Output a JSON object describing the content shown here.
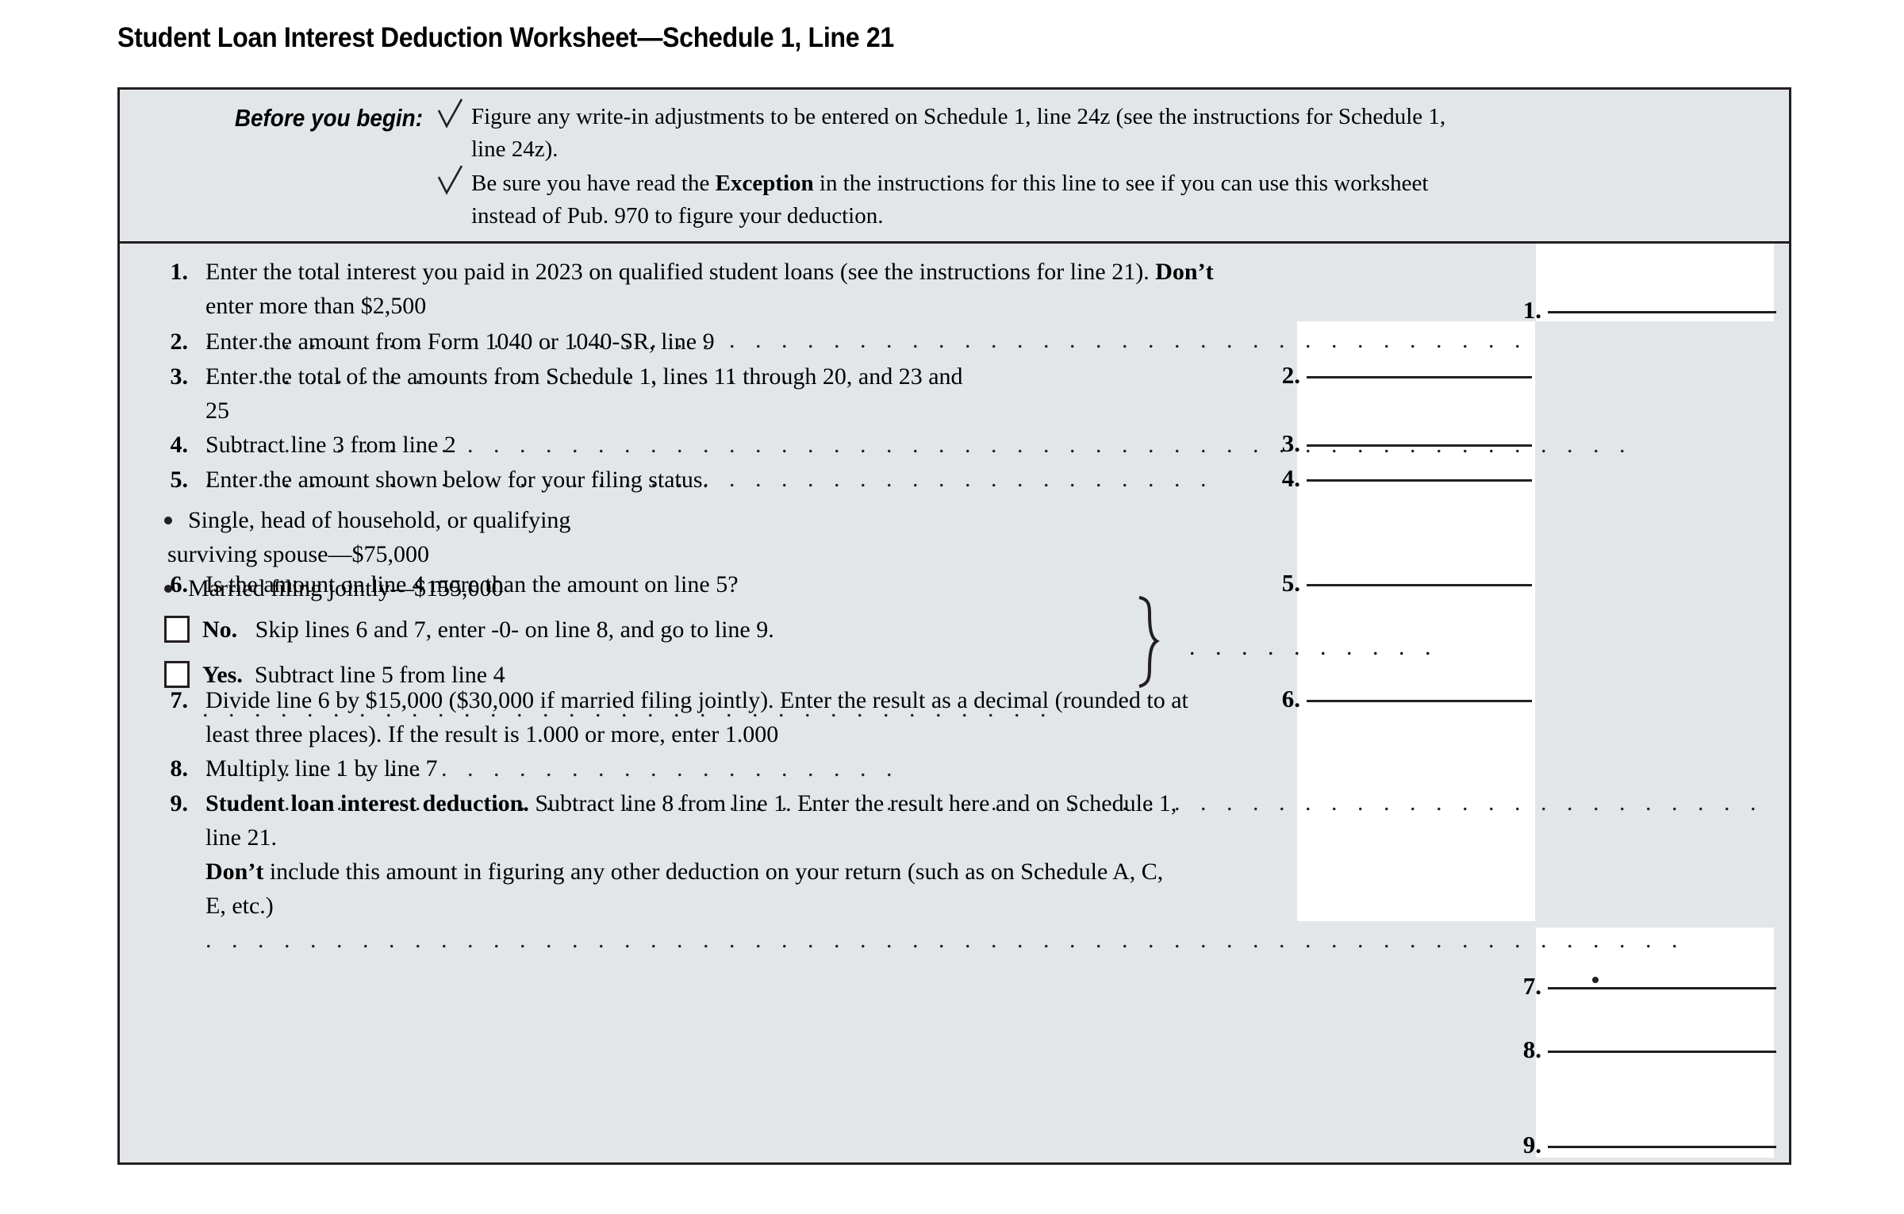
{
  "title": "Student Loan Interest Deduction Worksheet—Schedule 1, Line 21",
  "colors": {
    "panel_background": "#e3e6e9",
    "answer_box_background": "#ffffff",
    "rule": "#231f20",
    "text": "#000000"
  },
  "before_you_begin": {
    "label": "Before you begin:",
    "check_icon": "checkmark-icon",
    "items": [
      {
        "text_before": "Figure any write-in adjustments to be entered on Schedule 1, line 24z (see the instructions for Schedule 1, line 24z).",
        "part1": "Figure any write-in adjustments to be entered on Schedule 1, line 24z (see the instructions for Schedule 1,",
        "part2": "line 24z)."
      },
      {
        "text_before": "Be sure you have read the ",
        "bold": "Exception",
        "text_after": " in the instructions for this line to see if you can use this worksheet instead of Pub. 970 to figure your deduction.",
        "part1_a": "Be sure you have read the ",
        "part1_b": "Exception",
        "part1_c": " in the instructions for this line to see if you can use this worksheet",
        "part2": "instead of Pub. 970 to figure your deduction."
      }
    ]
  },
  "lines": [
    {
      "num": "1.",
      "text_a": "Enter the total interest you paid in 2023 on qualified student loans (see the instructions for line 21). ",
      "bold_a": "Don’t",
      "text_b": "enter more than $2,500",
      "leader": ". . . . . . . . . . . . . . . . . . . . . . . . . . . . . . . . . . . . . . . . . . . . . . . . . . ."
    },
    {
      "num": "2.",
      "text_a": "Enter the amount from Form 1040 or 1040-SR, line 9",
      "leader": ". . . . . . . . . . . . . . . . . . . . . . ."
    },
    {
      "num": "3.",
      "text_a": "Enter the total of the amounts from Schedule 1, lines 11 through 20, and 23 and",
      "text_b": "25",
      "leader": ". . . . . . . . . . . . . . . . . . . . . . . . . . . . . . . . . . . . . . . . . . . . . . . . . . . . . . ."
    },
    {
      "num": "4.",
      "text_a": "Subtract line 3 from line 2",
      "leader": ". . . . . . . . . . . . . . . . . . . . . . . . . . . . . . . . . . . . . . ."
    },
    {
      "num": "5.",
      "text_a": "Enter the amount shown below for your filing status.",
      "bullets": [
        {
          "line1": "Single, head of household, or qualifying",
          "line2": "surviving spouse—$75,000"
        },
        {
          "line1": "Married filing jointly—$155,000"
        }
      ],
      "brace": "}",
      "leader": ". . . . . . . . . ."
    },
    {
      "num": "6.",
      "text_a": "Is the amount on line 4 more than the amount on line 5?",
      "choices": [
        {
          "checkbox": "no-checkbox",
          "label": "No.",
          "text": "Skip lines 6 and 7, enter -0- on line 8, and go to line 9."
        },
        {
          "checkbox": "yes-checkbox",
          "label": "Yes.",
          "text": "Subtract line 5 from line 4",
          "leader": ". . . . . . . . . . . . . . . . . . . . . . . . . . . . . . . . ."
        }
      ]
    },
    {
      "num": "7.",
      "text_a": "Divide line 6 by $15,000 ($30,000 if married filing jointly). Enter the result as a decimal (rounded to at",
      "text_b": "least three places). If the result is 1.000 or more, enter 1.000",
      "leader": ". . . . . . . . . . . . . . . . . . . . . . . . . . ."
    },
    {
      "num": "8.",
      "text_a": "Multiply line 1 by line 7",
      "leader": ". . . . . . . . . . . . . . . . . . . . . . . . . . . . . . . . . . . . . . . . . . . . . . . . . . . . . . . . . . . ."
    },
    {
      "num": "9.",
      "bold_a": "Student loan interest deduction.",
      "text_a": " Subtract line 8 from line 1. Enter the result here and on Schedule 1,",
      "text_b": "line 21.",
      "bold_b": "Don’t",
      "text_c": " include this amount in figuring any other deduction on your return (such as on Schedule A, C,",
      "text_d": "E, etc.)",
      "leader": ". . . . . . . . . . . . . . . . . . . . . . . . . . . . . . . . . . . . . . . . . . . . . . . . . . . . . . . . ."
    }
  ],
  "answer_fields": [
    {
      "num": "1.",
      "value": "",
      "has_decimal_point": false
    },
    {
      "num": "2.",
      "value": "",
      "has_decimal_point": false
    },
    {
      "num": "3.",
      "value": "",
      "has_decimal_point": false
    },
    {
      "num": "4.",
      "value": "",
      "has_decimal_point": false
    },
    {
      "num": "5.",
      "value": "",
      "has_decimal_point": false
    },
    {
      "num": "6.",
      "value": "",
      "has_decimal_point": false
    },
    {
      "num": "7.",
      "value": "",
      "has_decimal_point": true
    },
    {
      "num": "8.",
      "value": "",
      "has_decimal_point": false
    },
    {
      "num": "9.",
      "value": "",
      "has_decimal_point": false
    }
  ]
}
